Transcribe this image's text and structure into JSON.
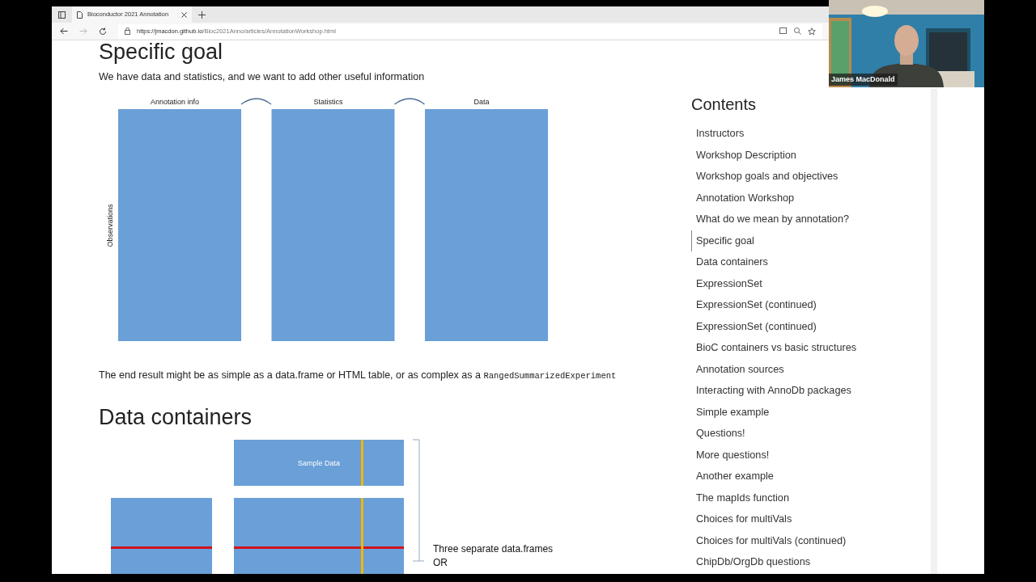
{
  "browser": {
    "tab_title": "Bioconductor 2021 Annotation",
    "url_host": "https://jmacdon.github.io",
    "url_path": "/Bioc2021Anno/articles/AnnotationWorkshop.html",
    "forward_disabled": true
  },
  "webcam": {
    "caption": "James MacDonald"
  },
  "article": {
    "heading": "Specific goal",
    "intro": "We have data and statistics, and we want to add other useful information",
    "diagram": {
      "columns": [
        "Annotation info",
        "Statistics",
        "Data"
      ],
      "row_label": "Observations"
    },
    "result_text": "The end result might be as simple as a data.frame or HTML table, or as complex as a ",
    "result_code": "RangedSummarizedExperiment",
    "heading_2": "Data containers",
    "diagram_2": {
      "box_label": "Sample Data",
      "note_lines": [
        "Three separate data.frames",
        "OR"
      ]
    }
  },
  "toc": {
    "title": "Contents",
    "items": [
      {
        "label": "Instructors",
        "selected": false
      },
      {
        "label": "Workshop Description",
        "selected": false
      },
      {
        "label": "Workshop goals and objectives",
        "selected": false
      },
      {
        "label": "Annotation Workshop",
        "selected": false
      },
      {
        "label": "What do we mean by annotation?",
        "selected": false
      },
      {
        "label": "Specific goal",
        "selected": true
      },
      {
        "label": "Data containers",
        "selected": false
      },
      {
        "label": "ExpressionSet",
        "selected": false
      },
      {
        "label": "ExpressionSet (continued)",
        "selected": false
      },
      {
        "label": "ExpressionSet (continued)",
        "selected": false
      },
      {
        "label": "BioC containers vs basic structures",
        "selected": false
      },
      {
        "label": "Annotation sources",
        "selected": false
      },
      {
        "label": "Interacting with AnnoDb packages",
        "selected": false
      },
      {
        "label": "Simple example",
        "selected": false
      },
      {
        "label": "Questions!",
        "selected": false
      },
      {
        "label": "More questions!",
        "selected": false
      },
      {
        "label": "Another example",
        "selected": false
      },
      {
        "label": "The mapIds function",
        "selected": false
      },
      {
        "label": "Choices for multiVals",
        "selected": false
      },
      {
        "label": "Choices for multiVals (continued)",
        "selected": false
      },
      {
        "label": "ChipDb/OrgDb questions",
        "selected": false
      }
    ]
  }
}
